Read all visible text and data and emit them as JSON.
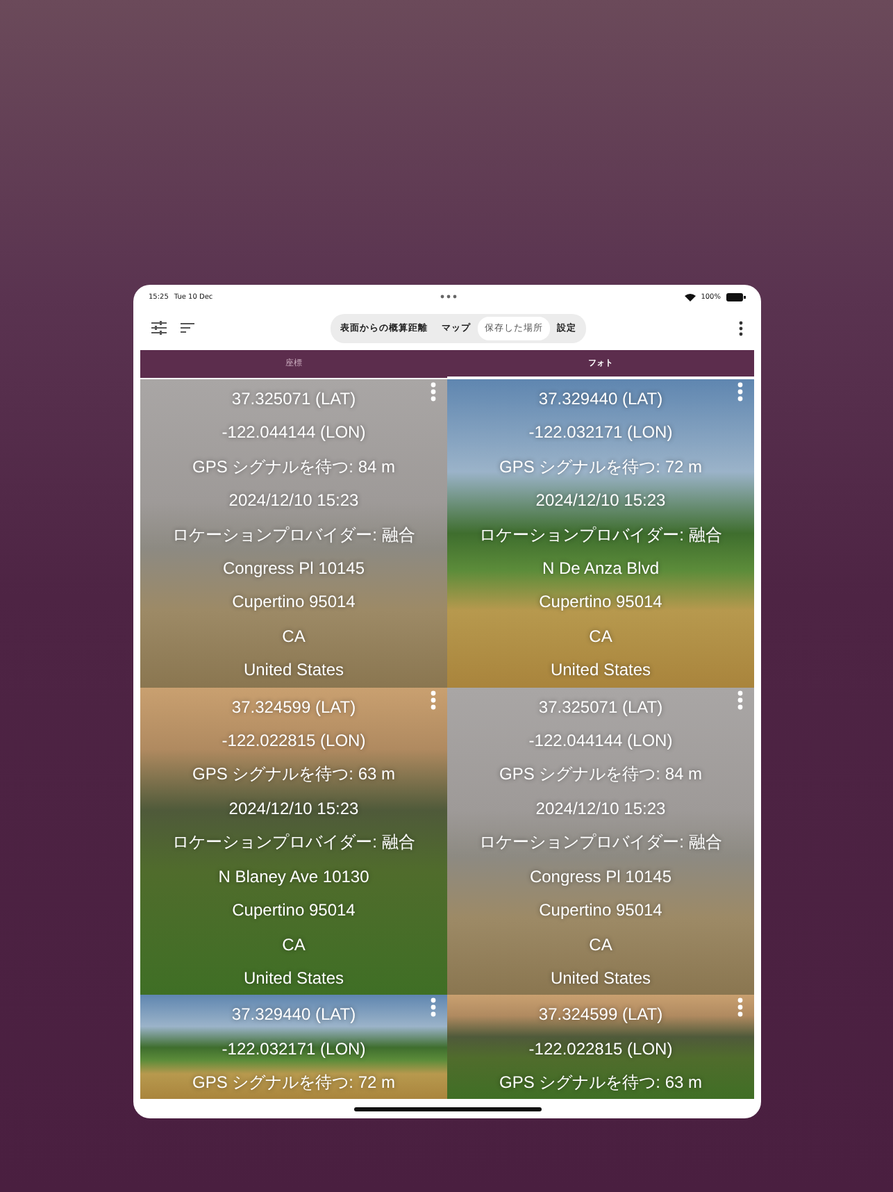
{
  "status_bar": {
    "time": "15:25",
    "date": "Tue 10 Dec",
    "battery": "100%"
  },
  "segments": [
    {
      "label": "表面からの概算距離",
      "selected": false
    },
    {
      "label": "マップ",
      "selected": false
    },
    {
      "label": "保存した場所",
      "selected": true
    },
    {
      "label": "設定",
      "selected": false
    }
  ],
  "tabs": [
    {
      "label": "座標",
      "selected": false
    },
    {
      "label": "フォト",
      "selected": true
    }
  ],
  "cards": [
    {
      "lines": [
        "37.325071 (LAT)",
        "-122.044144 (LON)",
        "GPS シグナルを待つ: 84 m",
        "2024/12/10 15:23",
        "ロケーションプロバイダー: 融合",
        "Congress Pl 10145",
        "Cupertino 95014",
        "CA",
        "United States"
      ]
    },
    {
      "lines": [
        "37.329440 (LAT)",
        "-122.032171 (LON)",
        "GPS シグナルを待つ: 72 m",
        "2024/12/10 15:23",
        "ロケーションプロバイダー: 融合",
        "N De Anza Blvd",
        "Cupertino 95014",
        "CA",
        "United States"
      ]
    },
    {
      "lines": [
        "37.324599 (LAT)",
        "-122.022815 (LON)",
        "GPS シグナルを待つ: 63 m",
        "2024/12/10 15:23",
        "ロケーションプロバイダー: 融合",
        "N Blaney Ave 10130",
        "Cupertino 95014",
        "CA",
        "United States"
      ]
    },
    {
      "lines": [
        "37.325071 (LAT)",
        "-122.044144 (LON)",
        "GPS シグナルを待つ: 84 m",
        "2024/12/10 15:23",
        "ロケーションプロバイダー: 融合",
        "Congress Pl 10145",
        "Cupertino 95014",
        "CA",
        "United States"
      ]
    },
    {
      "lines": [
        "37.329440 (LAT)",
        "-122.032171 (LON)",
        "GPS シグナルを待つ: 72 m"
      ]
    },
    {
      "lines": [
        "37.324599 (LAT)",
        "-122.022815 (LON)",
        "GPS シグナルを待つ: 63 m"
      ]
    }
  ]
}
